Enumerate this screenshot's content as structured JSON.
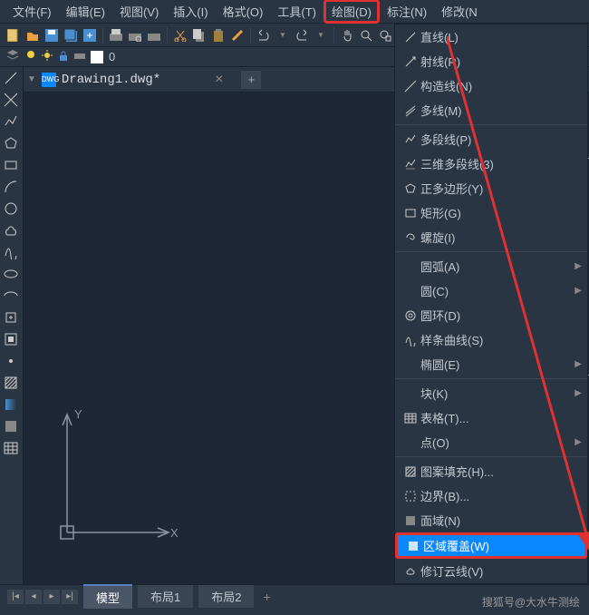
{
  "menubar": {
    "file": "文件(F)",
    "edit": "编辑(E)",
    "view": "视图(V)",
    "insert": "插入(I)",
    "format": "格式(O)",
    "tools": "工具(T)",
    "draw": "绘图(D)",
    "annotate": "标注(N)",
    "modify": "修改(N"
  },
  "toolbar2": {
    "value": "0"
  },
  "tab": {
    "filename": "Drawing1.dwg*"
  },
  "ucs": {
    "x": "X",
    "y": "Y"
  },
  "bottom": {
    "model": "模型",
    "layout1": "布局1",
    "layout2": "布局2"
  },
  "dropdown": {
    "line": "直线(L)",
    "ray": "射线(R)",
    "xline": "构造线(N)",
    "mline": "多线(M)",
    "pline": "多段线(P)",
    "3dpoly": "三维多段线(3)",
    "polygon": "正多边形(Y)",
    "rectangle": "矩形(G)",
    "spiral": "螺旋(I)",
    "arc": "圆弧(A)",
    "circle": "圆(C)",
    "donut": "圆环(D)",
    "spline": "样条曲线(S)",
    "ellipse": "椭圆(E)",
    "block": "块(K)",
    "table": "表格(T)...",
    "point": "点(O)",
    "hatch": "图案填充(H)...",
    "boundary": "边界(B)...",
    "region": "面域(N)",
    "wipeout": "区域覆盖(W)",
    "revcloud": "修订云线(V)"
  },
  "watermark": "搜狐号@大水牛测绘"
}
